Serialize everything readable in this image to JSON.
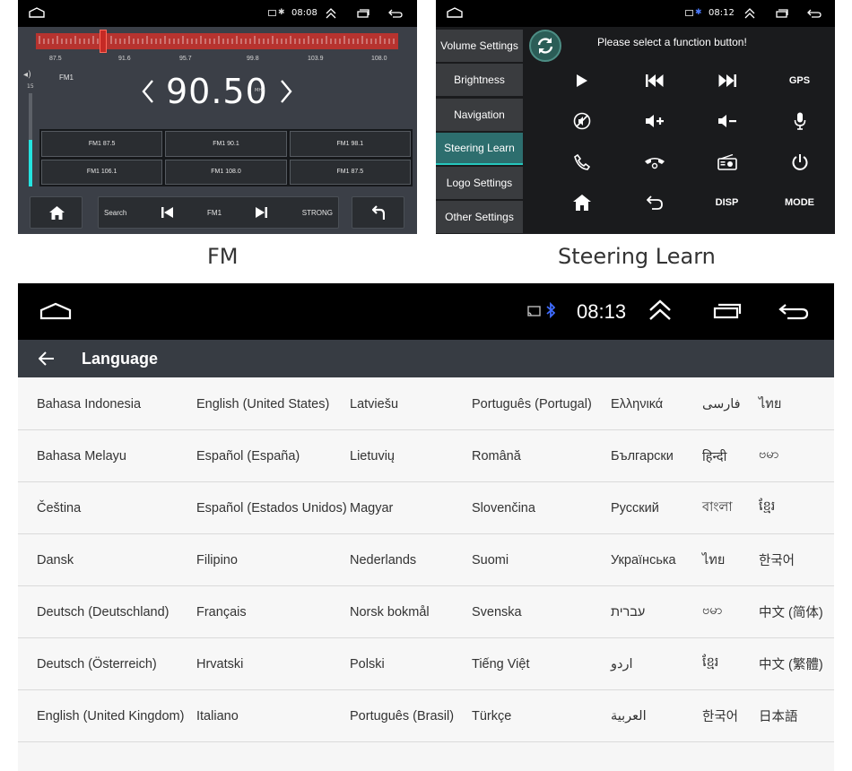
{
  "fm_panel": {
    "caption": "FM",
    "status": {
      "time": "08:08"
    },
    "scale_labels": [
      "87.5",
      "91.6",
      "95.7",
      "99.8",
      "103.9",
      "108.0"
    ],
    "volume_level": "15",
    "volume_fraction": 0.5,
    "band": "FM1",
    "frequency": "90.50",
    "unit": "MHz",
    "presets": [
      "FM1 87.5",
      "FM1 90.1",
      "FM1 98.1",
      "FM1 106.1",
      "FM1 108.0",
      "FM1 87.5"
    ],
    "controls": {
      "search": "Search",
      "band": "FM1",
      "signal": "STRONG"
    }
  },
  "steering_panel": {
    "caption": "Steering Learn",
    "status": {
      "time": "08:12"
    },
    "menu": [
      {
        "label": "Volume Settings",
        "active": false
      },
      {
        "label": "Brightness",
        "active": false
      },
      {
        "label": "Navigation",
        "active": false
      },
      {
        "label": "Steering Learn",
        "active": true
      },
      {
        "label": "Logo Settings",
        "active": false
      },
      {
        "label": "Other Settings",
        "active": false
      }
    ],
    "prompt": "Please select a function button!",
    "functions": [
      {
        "icon": "play-icon",
        "label": ""
      },
      {
        "icon": "previous-track-icon",
        "label": ""
      },
      {
        "icon": "next-track-icon",
        "label": ""
      },
      {
        "icon": "gps-icon",
        "label": "GPS"
      },
      {
        "icon": "mute-icon",
        "label": ""
      },
      {
        "icon": "volume-up-icon",
        "label": ""
      },
      {
        "icon": "volume-down-icon",
        "label": ""
      },
      {
        "icon": "microphone-icon",
        "label": ""
      },
      {
        "icon": "phone-answer-icon",
        "label": ""
      },
      {
        "icon": "phone-hangup-icon",
        "label": ""
      },
      {
        "icon": "radio-icon",
        "label": ""
      },
      {
        "icon": "power-icon",
        "label": ""
      },
      {
        "icon": "home-icon",
        "label": ""
      },
      {
        "icon": "back-icon",
        "label": ""
      },
      {
        "icon": "disp-icon",
        "label": "DISP"
      },
      {
        "icon": "mode-icon",
        "label": "MODE"
      }
    ]
  },
  "language_panel": {
    "status": {
      "time": "08:13"
    },
    "title": "Language",
    "rows": [
      [
        "Bahasa Indonesia",
        "English (United States)",
        "Latviešu",
        "Português (Portugal)",
        "Ελληνικά",
        "فارسی",
        "ไทย"
      ],
      [
        "Bahasa Melayu",
        "Español (España)",
        "Lietuvių",
        "Română",
        "Български",
        "हिन्दी",
        "ဗမာ"
      ],
      [
        "Čeština",
        "Español (Estados Unidos)",
        "Magyar",
        "Slovenčina",
        "Русский",
        "বাংলা",
        "ខ្មែរ"
      ],
      [
        "Dansk",
        "Filipino",
        "Nederlands",
        "Suomi",
        "Українська",
        "ไทย",
        "한국어"
      ],
      [
        "Deutsch (Deutschland)",
        "Français",
        "Norsk bokmål",
        "Svenska",
        "עברית",
        "ဗမာ",
        "中文 (简体)"
      ],
      [
        "Deutsch (Österreich)",
        "Hrvatski",
        "Polski",
        "Tiếng Việt",
        "اردو",
        "ខ្មែរ",
        "中文 (繁體)"
      ],
      [
        "English (United Kingdom)",
        "Italiano",
        "Português (Brasil)",
        "Türkçe",
        "العربية",
        "한국어",
        "日本語"
      ]
    ]
  }
}
